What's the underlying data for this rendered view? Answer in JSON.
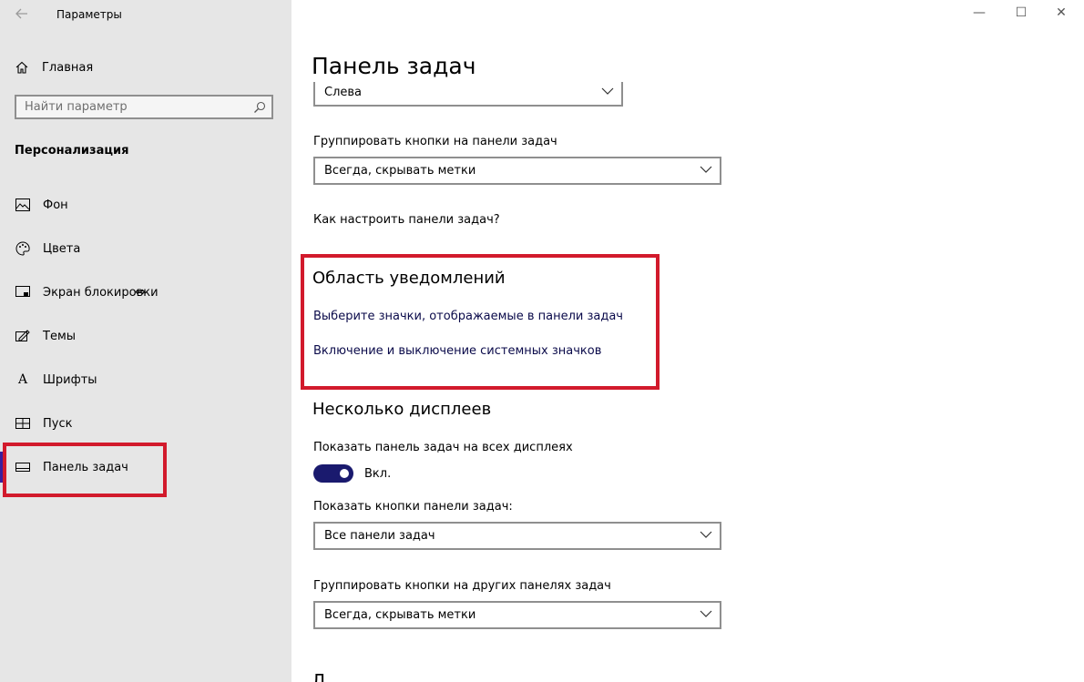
{
  "window": {
    "app_title": "Параметры",
    "back_icon": "back-arrow-icon",
    "controls": [
      "minimize",
      "maximize",
      "close"
    ]
  },
  "sidebar": {
    "home_label": "Главная",
    "search_placeholder": "Найти параметр",
    "section_label": "Персонализация",
    "items": [
      {
        "label": "Фон",
        "icon": "picture-icon"
      },
      {
        "label": "Цвета",
        "icon": "palette-icon"
      },
      {
        "label": "Экран блокировки",
        "icon": "lock-screen-icon"
      },
      {
        "label": "Темы",
        "icon": "themes-icon"
      },
      {
        "label": "Шрифты",
        "icon": "font-icon"
      },
      {
        "label": "Пуск",
        "icon": "start-icon"
      },
      {
        "label": "Панель задач",
        "icon": "taskbar-icon",
        "active": true
      }
    ],
    "accent_color": "#3a1f9e"
  },
  "main": {
    "page_title": "Панель задач",
    "position_select": "Слева",
    "group_buttons_label": "Группировать кнопки на панели задач",
    "group_buttons_value": "Всегда, скрывать метки",
    "customize_link": "Как настроить панели задач?",
    "notification_heading": "Область уведомлений",
    "select_icons_link": "Выберите значки, отображаемые в панели задач",
    "system_icons_link": "Включение и выключение системных значков",
    "multi_display_heading": "Несколько дисплеев",
    "show_all_displays_label": "Показать панель задач на всех дисплеях",
    "show_all_displays_state": "Вкл.",
    "show_buttons_label": "Показать кнопки панели задач:",
    "show_buttons_value": "Все панели задач",
    "group_other_label": "Группировать кнопки на других панелях задач",
    "group_other_value": "Всегда, скрывать метки",
    "next_heading_partial": "Л"
  },
  "colors": {
    "highlight_red": "#d21a2c",
    "toggle_on": "#1a1a6e"
  }
}
